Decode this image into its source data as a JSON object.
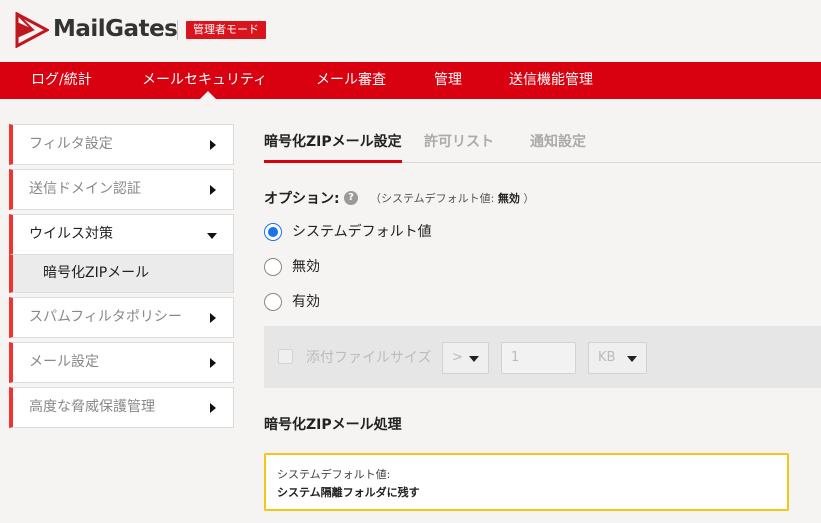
{
  "header": {
    "brand": "MailGates",
    "admin_badge": "管理者モード"
  },
  "topnav": {
    "items": [
      "ログ/統計",
      "メールセキュリティ",
      "メール審査",
      "管理",
      "送信機能管理"
    ],
    "active": "メールセキュリティ"
  },
  "sidebar": {
    "items": [
      {
        "label": "フィルタ設定"
      },
      {
        "label": "送信ドメイン認証"
      },
      {
        "label": "ウイルス対策",
        "sub": "暗号化ZIPメール"
      },
      {
        "label": "スパムフィルタポリシー"
      },
      {
        "label": "メール設定"
      },
      {
        "label": "高度な脅威保護管理"
      }
    ]
  },
  "tabs": [
    "暗号化ZIPメール設定",
    "許可リスト",
    "通知設定"
  ],
  "options": {
    "title": "オプション:",
    "help_icon": "?",
    "note_prefix": "（システムデフォルト値: ",
    "note_value": "無効",
    "note_suffix": " ）",
    "radios": [
      "システムデフォルト値",
      "無効",
      "有効"
    ],
    "selected": "システムデフォルト値"
  },
  "attachment": {
    "label": "添付ファイルサイズ",
    "operator": ">",
    "size_value": "1",
    "unit": "KB"
  },
  "processing": {
    "title": "暗号化ZIPメール処理",
    "default_label": "システムデフォルト値:",
    "default_value": "システム隔離フォルダに残す"
  },
  "colors": {
    "brand_red": "#d9000f",
    "radio_blue": "#1a73e8",
    "highlight_yellow": "#f5c518"
  }
}
